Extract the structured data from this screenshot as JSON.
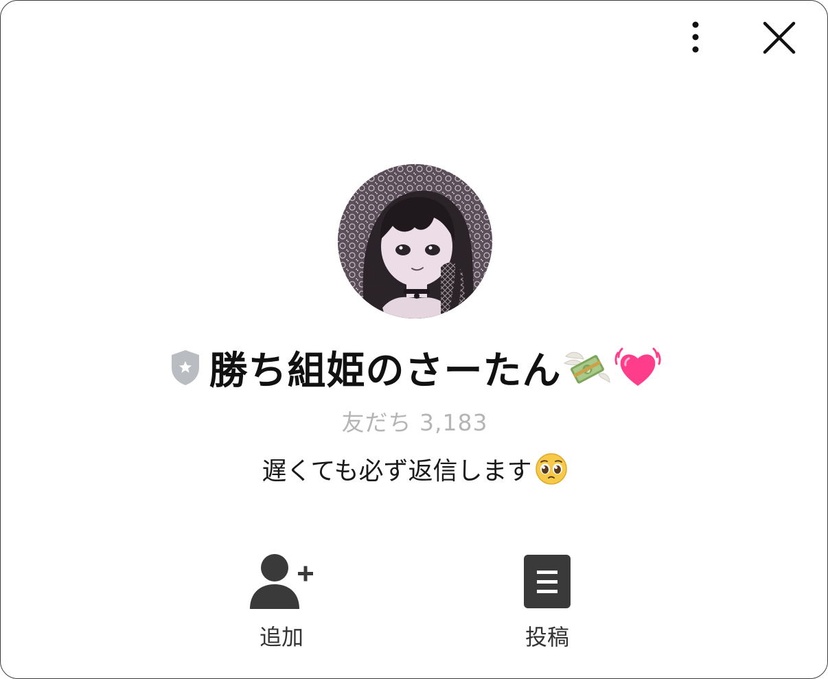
{
  "header": {
    "more_icon": "vertical-ellipsis-icon",
    "close_icon": "close-x-icon"
  },
  "profile": {
    "name": "勝ち組姫のさーたん",
    "badge_icon": "shield-star-icon",
    "name_emojis": [
      "money-with-wings-emoji",
      "beating-heart-emoji"
    ],
    "friends_label": "友だち 3,183",
    "status_message": "遅くても必ず返信します",
    "status_emoji": "pleading-face-emoji"
  },
  "actions": [
    {
      "label": "追加",
      "icon": "add-friend-icon"
    },
    {
      "label": "投稿",
      "icon": "posts-icon"
    }
  ],
  "colors": {
    "text_primary": "#111111",
    "text_muted": "#b5b5b5",
    "icon_dark": "#3a3a3a",
    "badge_gray": "#b9bdc2",
    "heart_pink": "#ff3d8b"
  }
}
